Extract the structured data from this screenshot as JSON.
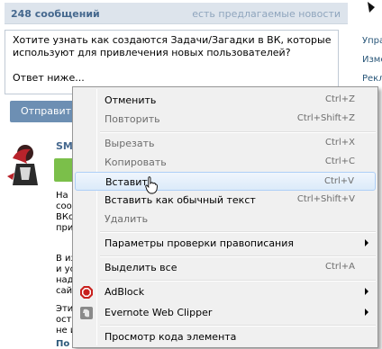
{
  "header": {
    "count_label": "248 сообщений",
    "suggest_link": "есть предлагаемые новости"
  },
  "right_nav": {
    "items": [
      "Упра",
      "Изме",
      "Рекл"
    ]
  },
  "compose": {
    "text": "Хотите узнать как создаются Задачи/Загадки в ВК, которые\nиспользуют для привлечения новых пользователей?\n\nОтвет ниже...",
    "send_label": "Отправить"
  },
  "post": {
    "author": "SM",
    "fragments": [
      "На",
      "соо",
      "ВКо",
      "при",
      "В из",
      "и ус",
      "надо",
      "сай",
      "Эти",
      "ост",
      "не и"
    ],
    "more_link": "По"
  },
  "context_menu": {
    "items": [
      {
        "label": "Отменить",
        "shortcut": "Ctrl+Z",
        "disabled": false
      },
      {
        "label": "Повторить",
        "shortcut": "Ctrl+Shift+Z",
        "disabled": true
      },
      {
        "label": "Вырезать",
        "shortcut": "Ctrl+X",
        "disabled": true
      },
      {
        "label": "Копировать",
        "shortcut": "Ctrl+C",
        "disabled": true
      },
      {
        "label": "Вставить",
        "shortcut": "Ctrl+V",
        "disabled": false,
        "highlighted": true
      },
      {
        "label": "Вставить как обычный текст",
        "shortcut": "Ctrl+Shift+V",
        "disabled": false
      },
      {
        "label": "Удалить",
        "shortcut": "",
        "disabled": true
      },
      {
        "label": "Параметры проверки правописания",
        "shortcut": "",
        "submenu": true
      },
      {
        "label": "Выделить все",
        "shortcut": "Ctrl+A",
        "disabled": false
      },
      {
        "label": "AdBlock",
        "icon": "adblock-icon",
        "submenu": true
      },
      {
        "label": "Evernote Web Clipper",
        "icon": "evernote-icon",
        "submenu": true
      },
      {
        "label": "Просмотр кода элемента",
        "shortcut": ""
      }
    ]
  },
  "colors": {
    "menu_bg": "#f0f0f0",
    "highlight": "#dbeaf9",
    "vk_blue": "#45688e",
    "button": "#6d8fb3",
    "adblock_red": "#c8201d"
  }
}
